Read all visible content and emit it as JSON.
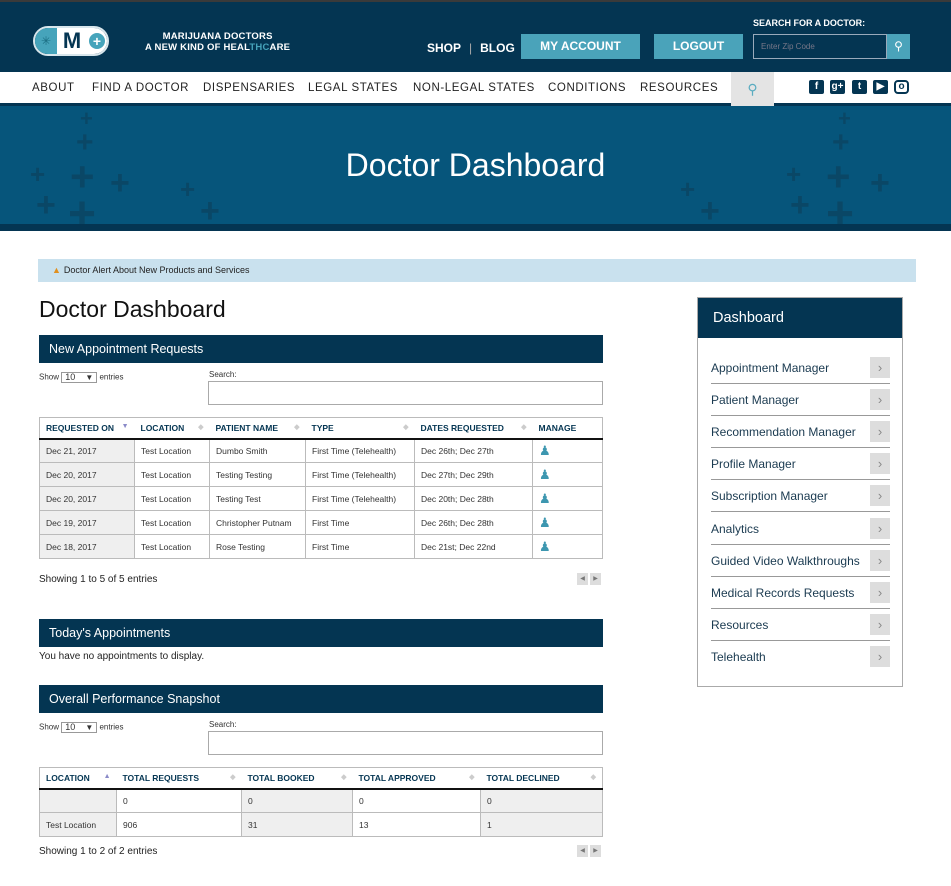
{
  "header": {
    "logo_text": "MD",
    "tagline_line1": "MARIJUANA DOCTORS",
    "tagline_line2_pre": "A NEW KIND OF HEAL",
    "tagline_line2_thc": "THC",
    "tagline_line2_post": "ARE",
    "shop": "SHOP",
    "separator": "|",
    "blog": "BLOG",
    "my_account": "MY ACCOUNT",
    "logout": "LOGOUT",
    "search_label": "SEARCH FOR A DOCTOR:",
    "zip_placeholder": "Enter Zip Code"
  },
  "nav": {
    "items": [
      "ABOUT",
      "FIND A DOCTOR",
      "DISPENSARIES",
      "LEGAL STATES",
      "NON-LEGAL STATES",
      "CONDITIONS",
      "RESOURCES"
    ],
    "social": [
      "facebook-icon",
      "google-plus-icon",
      "twitter-icon",
      "youtube-icon",
      "instagram-icon"
    ]
  },
  "hero": {
    "title": "Doctor Dashboard"
  },
  "alert": {
    "text": "Doctor Alert About New Products and Services"
  },
  "page_title": "Doctor Dashboard",
  "appointments": {
    "title": "New Appointment Requests",
    "show": "Show",
    "entries_value": "10",
    "entries": "entries",
    "search_label": "Search:",
    "columns": [
      "REQUESTED ON",
      "LOCATION",
      "PATIENT NAME",
      "TYPE",
      "DATES REQUESTED",
      "MANAGE"
    ],
    "rows": [
      [
        "Dec 21, 2017",
        "Test Location",
        "Dumbo Smith",
        "First Time (Telehealth)",
        "Dec 26th; Dec 27th"
      ],
      [
        "Dec 20, 2017",
        "Test Location",
        "Testing Testing",
        "First Time (Telehealth)",
        "Dec 27th; Dec 29th"
      ],
      [
        "Dec 20, 2017",
        "Test Location",
        "Testing Test",
        "First Time (Telehealth)",
        "Dec 20th; Dec 28th"
      ],
      [
        "Dec 19, 2017",
        "Test Location",
        "Christopher Putnam",
        "First Time",
        "Dec 26th; Dec 28th"
      ],
      [
        "Dec 18, 2017",
        "Test Location",
        "Rose Testing",
        "First Time",
        "Dec 21st; Dec 22nd"
      ]
    ],
    "info": "Showing 1 to 5 of 5 entries"
  },
  "today": {
    "title": "Today's Appointments",
    "empty": "You have no appointments to display."
  },
  "performance": {
    "title": "Overall Performance Snapshot",
    "show": "Show",
    "entries_value": "10",
    "entries": "entries",
    "search_label": "Search:",
    "columns": [
      "LOCATION",
      "TOTAL REQUESTS",
      "TOTAL BOOKED",
      "TOTAL APPROVED",
      "TOTAL DECLINED"
    ],
    "rows": [
      [
        "",
        "0",
        "0",
        "0",
        "0"
      ],
      [
        "Test Location",
        "906",
        "31",
        "13",
        "1"
      ]
    ],
    "info": "Showing 1 to 2 of 2 entries"
  },
  "sidebar": {
    "title": "Dashboard",
    "items": [
      "Appointment Manager",
      "Patient Manager",
      "Recommendation Manager",
      "Profile Manager",
      "Subscription Manager",
      "Analytics",
      "Guided Video Walkthroughs",
      "Medical Records Requests",
      "Resources",
      "Telehealth"
    ]
  }
}
